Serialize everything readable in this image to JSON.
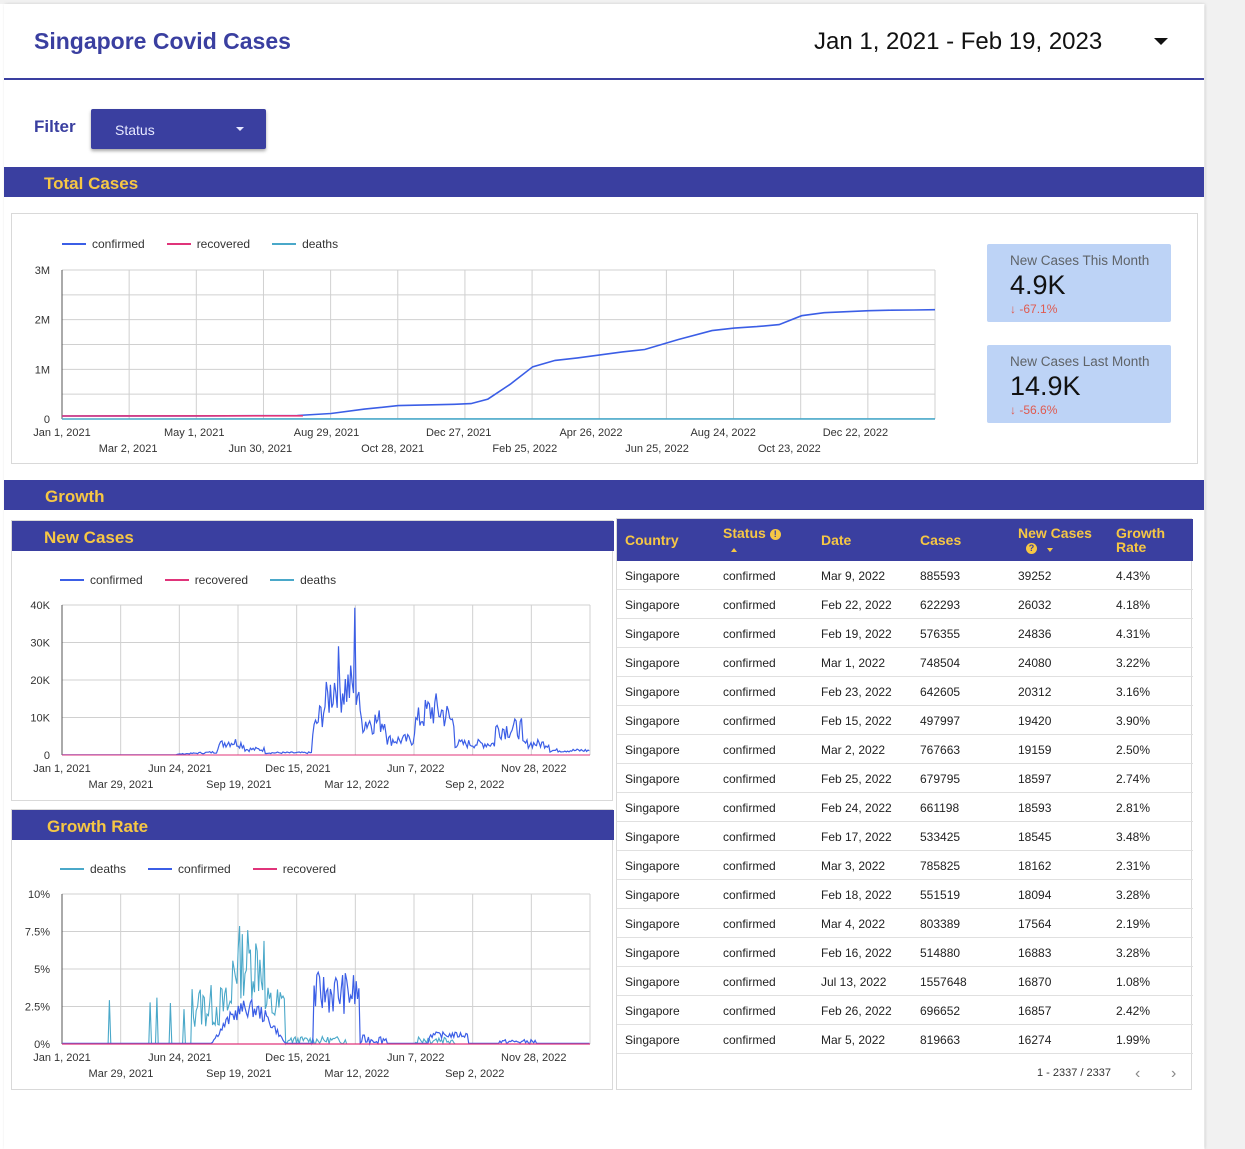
{
  "header": {
    "title": "Singapore Covid Cases",
    "date_range": "Jan 1, 2021 - Feb 19, 2023"
  },
  "filter": {
    "label": "Filter",
    "dropdown_label": "Status"
  },
  "sections": {
    "total_cases": "Total Cases",
    "growth": "Growth",
    "new_cases": "New Cases",
    "growth_rate": "Growth Rate"
  },
  "colors": {
    "accent": "#3a3fa0",
    "header_text": "#f6c744",
    "confirmed": "#3b5ee6",
    "recovered": "#e0347a",
    "deaths": "#4aa8c9",
    "scorecard_bg": "#bdd3f6",
    "negative": "#e05a4f"
  },
  "scorecards": [
    {
      "label": "New Cases This Month",
      "value": "4.9K",
      "change": "-67.1%"
    },
    {
      "label": "New Cases Last Month",
      "value": "14.9K",
      "change": "-56.6%"
    }
  ],
  "chart_data": [
    {
      "type": "line",
      "name": "Total Cases",
      "legend": [
        "confirmed",
        "recovered",
        "deaths"
      ],
      "y_ticks": [
        "3M",
        "2M",
        "1M",
        "0"
      ],
      "x_ticks_top": [
        "Jan 1, 2021",
        "May 1, 2021",
        "Aug 29, 2021",
        "Dec 27, 2021",
        "Apr 26, 2022",
        "Aug 24, 2022",
        "Dec 22, 2022"
      ],
      "x_ticks_bottom": [
        "Mar 2, 2021",
        "Jun 30, 2021",
        "Oct 28, 2021",
        "Feb 25, 2022",
        "Jun 25, 2022",
        "Oct 23, 2022"
      ],
      "ylim": [
        0,
        3000000
      ],
      "x_range_days": [
        0,
        779
      ],
      "series": [
        {
          "name": "confirmed",
          "x_days": [
            0,
            120,
            210,
            240,
            270,
            300,
            330,
            350,
            365,
            380,
            400,
            420,
            440,
            460,
            480,
            500,
            520,
            550,
            580,
            600,
            620,
            640,
            660,
            680,
            700,
            720,
            740,
            760,
            779
          ],
          "values": [
            60000,
            62000,
            70000,
            110000,
            200000,
            270000,
            285000,
            295000,
            310000,
            400000,
            700000,
            1050000,
            1180000,
            1230000,
            1290000,
            1350000,
            1400000,
            1600000,
            1780000,
            1830000,
            1860000,
            1900000,
            2080000,
            2140000,
            2160000,
            2180000,
            2190000,
            2195000,
            2200000
          ]
        },
        {
          "name": "recovered",
          "x_days": [
            0,
            215
          ],
          "values": [
            60000,
            64000
          ]
        },
        {
          "name": "deaths",
          "x_days": [
            0,
            779
          ],
          "values": [
            0,
            1700
          ]
        }
      ]
    },
    {
      "type": "line",
      "name": "New Cases",
      "legend": [
        "confirmed",
        "recovered",
        "deaths"
      ],
      "y_ticks": [
        "40K",
        "30K",
        "20K",
        "10K",
        "0"
      ],
      "x_ticks_top": [
        "Jan 1, 2021",
        "Jun 24, 2021",
        "Dec 15, 2021",
        "Jun 7, 2022",
        "Nov 28, 2022"
      ],
      "x_ticks_bottom": [
        "Mar 29, 2021",
        "Sep 19, 2021",
        "Mar 12, 2022",
        "Sep 2, 2022"
      ],
      "ylim": [
        0,
        40000
      ]
    },
    {
      "type": "line",
      "name": "Growth Rate",
      "legend": [
        "deaths",
        "confirmed",
        "recovered"
      ],
      "y_ticks": [
        "10%",
        "7.5%",
        "5%",
        "2.5%",
        "0%"
      ],
      "x_ticks_top": [
        "Jan 1, 2021",
        "Jun 24, 2021",
        "Dec 15, 2021",
        "Jun 7, 2022",
        "Nov 28, 2022"
      ],
      "x_ticks_bottom": [
        "Mar 29, 2021",
        "Sep 19, 2021",
        "Mar 12, 2022",
        "Sep 2, 2022"
      ],
      "ylim": [
        0,
        10
      ]
    }
  ],
  "table": {
    "columns": [
      "Country",
      "Status",
      "Date",
      "Cases",
      "New Cases",
      "Growth Rate"
    ],
    "column_growth_line1": "Growth",
    "column_growth_line2": "Rate",
    "rows": [
      [
        "Singapore",
        "confirmed",
        "Mar 9, 2022",
        "885593",
        "39252",
        "4.43%"
      ],
      [
        "Singapore",
        "confirmed",
        "Feb 22, 2022",
        "622293",
        "26032",
        "4.18%"
      ],
      [
        "Singapore",
        "confirmed",
        "Feb 19, 2022",
        "576355",
        "24836",
        "4.31%"
      ],
      [
        "Singapore",
        "confirmed",
        "Mar 1, 2022",
        "748504",
        "24080",
        "3.22%"
      ],
      [
        "Singapore",
        "confirmed",
        "Feb 23, 2022",
        "642605",
        "20312",
        "3.16%"
      ],
      [
        "Singapore",
        "confirmed",
        "Feb 15, 2022",
        "497997",
        "19420",
        "3.90%"
      ],
      [
        "Singapore",
        "confirmed",
        "Mar 2, 2022",
        "767663",
        "19159",
        "2.50%"
      ],
      [
        "Singapore",
        "confirmed",
        "Feb 25, 2022",
        "679795",
        "18597",
        "2.74%"
      ],
      [
        "Singapore",
        "confirmed",
        "Feb 24, 2022",
        "661198",
        "18593",
        "2.81%"
      ],
      [
        "Singapore",
        "confirmed",
        "Feb 17, 2022",
        "533425",
        "18545",
        "3.48%"
      ],
      [
        "Singapore",
        "confirmed",
        "Mar 3, 2022",
        "785825",
        "18162",
        "2.31%"
      ],
      [
        "Singapore",
        "confirmed",
        "Feb 18, 2022",
        "551519",
        "18094",
        "3.28%"
      ],
      [
        "Singapore",
        "confirmed",
        "Mar 4, 2022",
        "803389",
        "17564",
        "2.19%"
      ],
      [
        "Singapore",
        "confirmed",
        "Feb 16, 2022",
        "514880",
        "16883",
        "3.28%"
      ],
      [
        "Singapore",
        "confirmed",
        "Jul 13, 2022",
        "1557648",
        "16870",
        "1.08%"
      ],
      [
        "Singapore",
        "confirmed",
        "Feb 26, 2022",
        "696652",
        "16857",
        "2.42%"
      ],
      [
        "Singapore",
        "confirmed",
        "Mar 5, 2022",
        "819663",
        "16274",
        "1.99%"
      ]
    ],
    "pagination": "1 - 2337 / 2337",
    "prev_icon": "chevron-left-icon",
    "next_icon": "chevron-right-icon"
  }
}
